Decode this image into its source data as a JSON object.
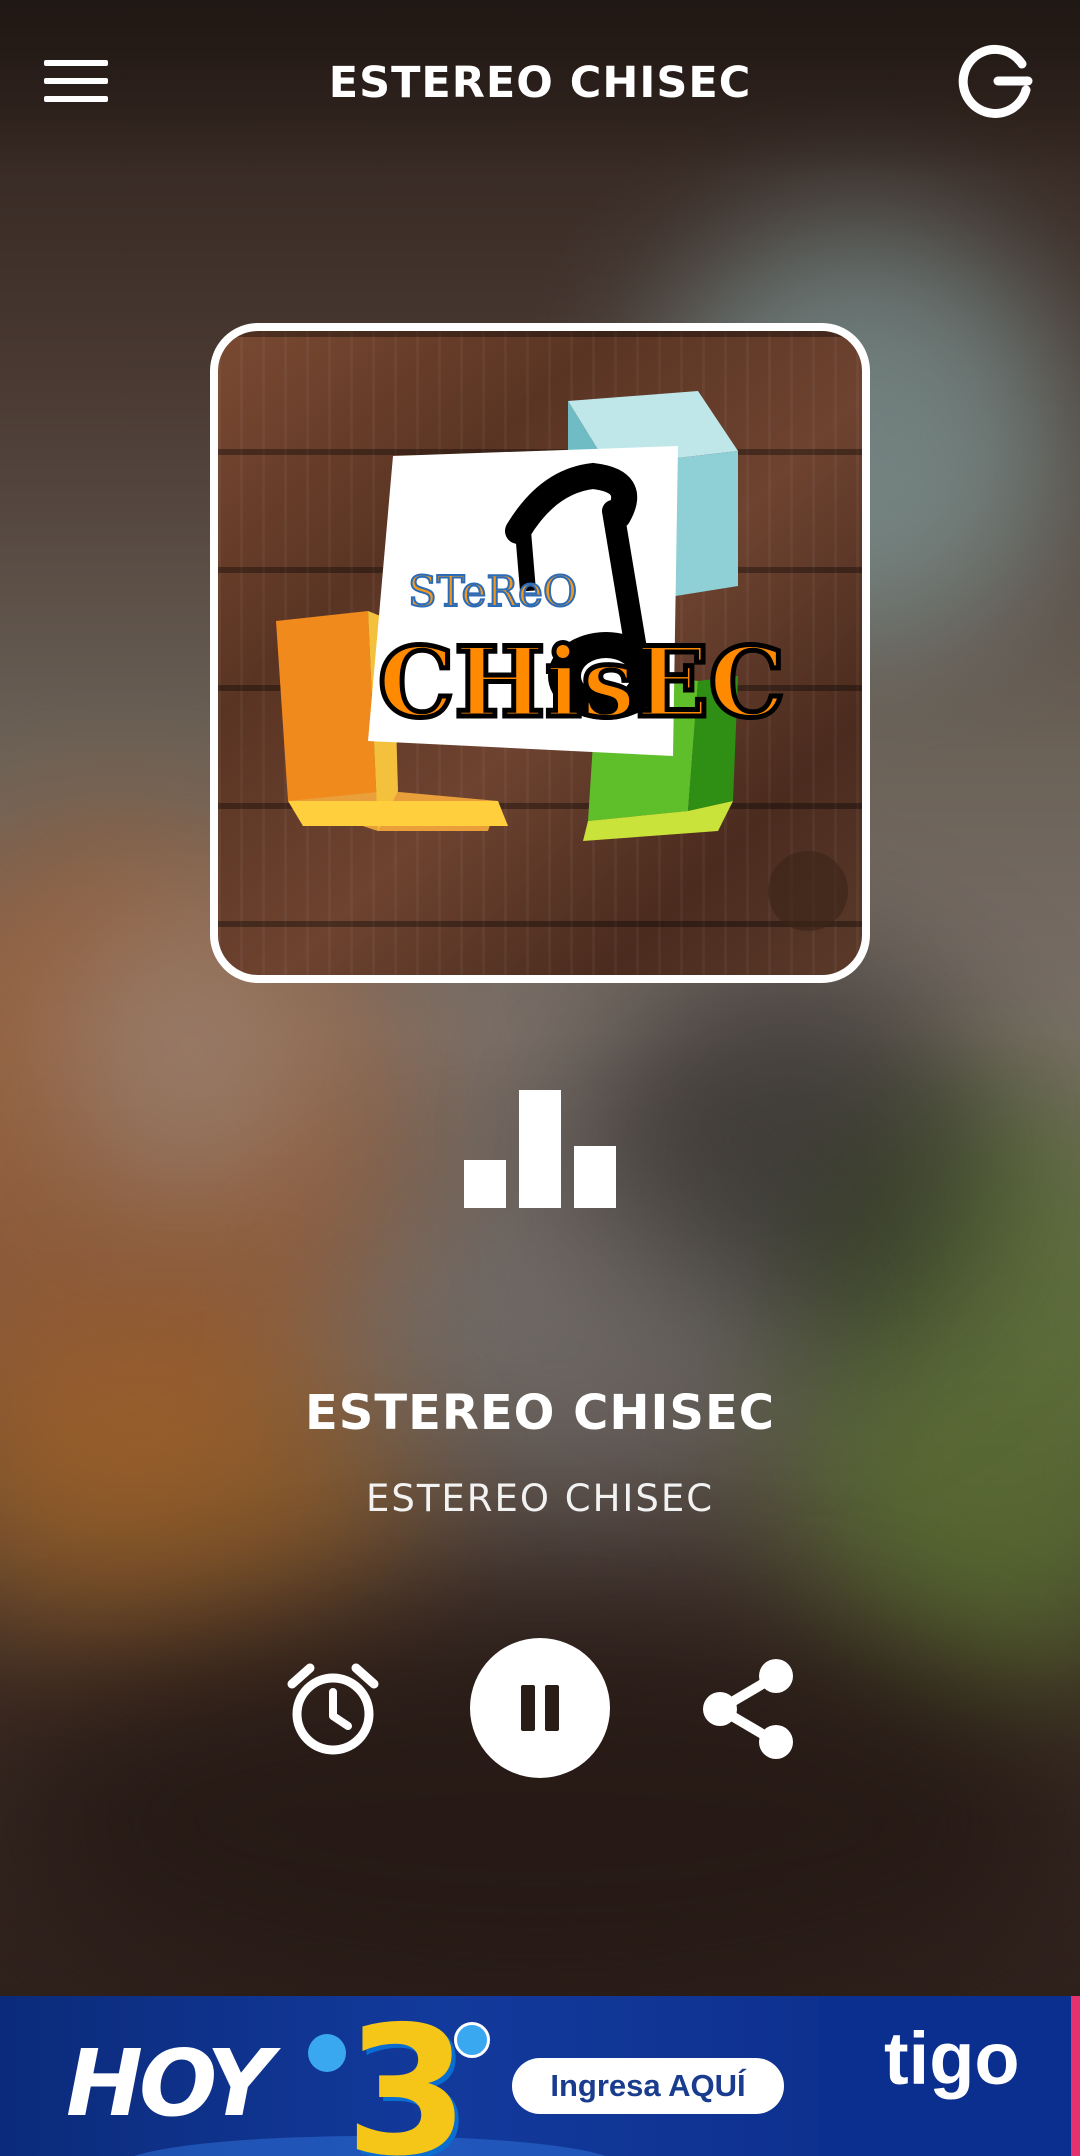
{
  "header": {
    "title": "ESTEREO CHISEC",
    "menu_icon": "hamburger-menu-icon",
    "power_icon": "power-exit-icon"
  },
  "artwork": {
    "logo_text_top": "STeReO",
    "logo_text_main": "CHisEC"
  },
  "now_playing": {
    "equalizer_icon": "equalizer-bars-icon",
    "title": "ESTEREO CHISEC",
    "subtitle": "ESTEREO CHISEC"
  },
  "controls": {
    "timer_icon": "alarm-clock-icon",
    "play_state": "playing",
    "pause_icon": "pause-icon",
    "share_icon": "share-icon"
  },
  "ad": {
    "headline": "HOY",
    "number": "3",
    "cta": "Ingresa AQUÍ",
    "brand": "tigo",
    "colors": {
      "background": "#123a9c",
      "accent": "#f5c518",
      "stripe": "#e5326f"
    }
  }
}
